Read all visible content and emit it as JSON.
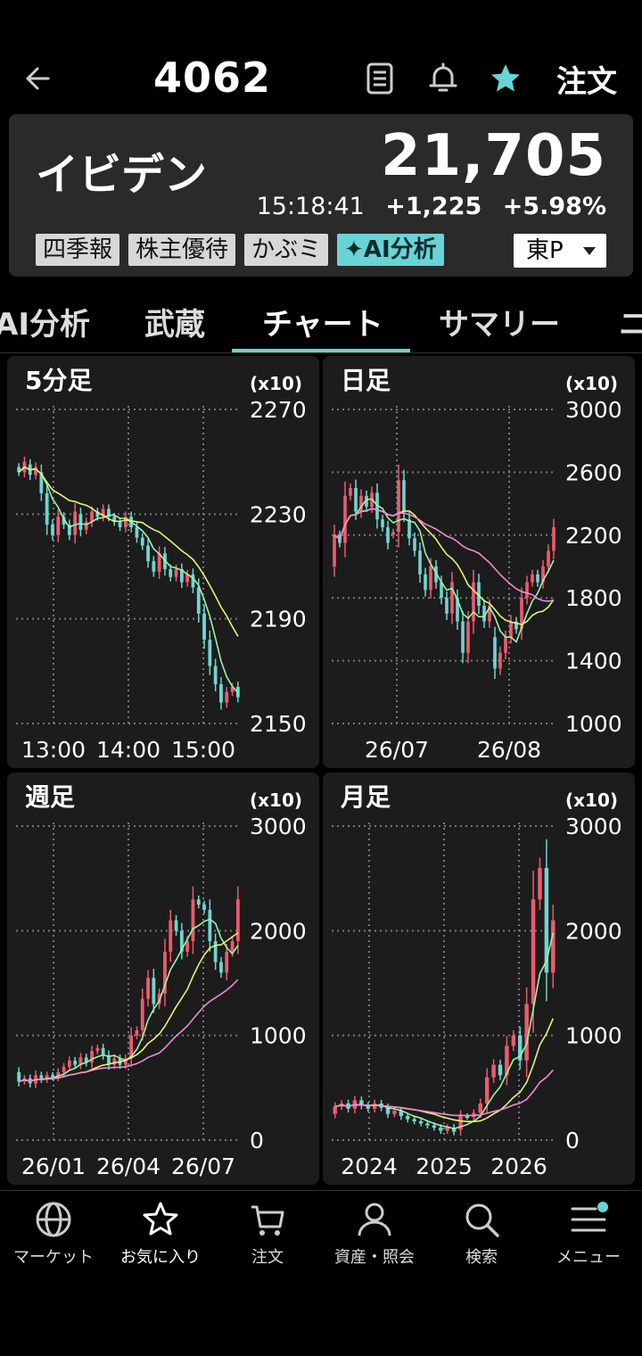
{
  "header": {
    "code": "4062",
    "order_label": "注文"
  },
  "quote": {
    "name": "イビデン",
    "price": "21,705",
    "time": "15:18:41",
    "change": "+1,225",
    "change_pct": "+5.98%",
    "tags": [
      "四季報",
      "株主優待",
      "かぶミ",
      "✦AI分析"
    ],
    "market": "東P"
  },
  "tabs": [
    "AI分析",
    "武蔵",
    "チャート",
    "サマリー",
    "ニ"
  ],
  "active_tab": "チャート",
  "colors": {
    "accent": "#69d3d6",
    "up": "#ef5a6f",
    "down": "#6fd6d2",
    "ma_short": "#9cf5a8",
    "ma_mid": "#e6f27a",
    "ma_long": "#f08ad6"
  },
  "chart_data": [
    {
      "type": "candlestick",
      "title": "5分足",
      "unit_label": "(x10)",
      "yticks": [
        2270,
        2230,
        2190,
        2150
      ],
      "ylim": [
        2150,
        2270
      ],
      "xticks": [
        "13:00",
        "14:00",
        "15:00"
      ],
      "grid": true,
      "ma": [
        "short",
        "mid"
      ],
      "series": [
        {
          "o": 2248,
          "c": 2246
        },
        {
          "o": 2246,
          "c": 2250
        },
        {
          "o": 2249,
          "c": 2245
        },
        {
          "o": 2245,
          "c": 2248
        },
        {
          "o": 2246,
          "c": 2238
        },
        {
          "o": 2238,
          "c": 2226
        },
        {
          "o": 2226,
          "c": 2222
        },
        {
          "o": 2222,
          "c": 2229
        },
        {
          "o": 2229,
          "c": 2226
        },
        {
          "o": 2226,
          "c": 2222
        },
        {
          "o": 2222,
          "c": 2231
        },
        {
          "o": 2230,
          "c": 2224
        },
        {
          "o": 2224,
          "c": 2227
        },
        {
          "o": 2227,
          "c": 2231
        },
        {
          "o": 2231,
          "c": 2229
        },
        {
          "o": 2229,
          "c": 2232
        },
        {
          "o": 2232,
          "c": 2229
        },
        {
          "o": 2229,
          "c": 2227
        },
        {
          "o": 2227,
          "c": 2225
        },
        {
          "o": 2225,
          "c": 2229
        },
        {
          "o": 2229,
          "c": 2225
        },
        {
          "o": 2225,
          "c": 2221
        },
        {
          "o": 2221,
          "c": 2218
        },
        {
          "o": 2218,
          "c": 2212
        },
        {
          "o": 2212,
          "c": 2208
        },
        {
          "o": 2208,
          "c": 2215
        },
        {
          "o": 2215,
          "c": 2209
        },
        {
          "o": 2209,
          "c": 2206
        },
        {
          "o": 2206,
          "c": 2209
        },
        {
          "o": 2209,
          "c": 2204
        },
        {
          "o": 2204,
          "c": 2207
        },
        {
          "o": 2207,
          "c": 2202
        },
        {
          "o": 2202,
          "c": 2192
        },
        {
          "o": 2192,
          "c": 2182
        },
        {
          "o": 2182,
          "c": 2172
        },
        {
          "o": 2172,
          "c": 2165
        },
        {
          "o": 2165,
          "c": 2158
        },
        {
          "o": 2158,
          "c": 2162
        },
        {
          "o": 2162,
          "c": 2164
        },
        {
          "o": 2164,
          "c": 2160
        }
      ]
    },
    {
      "type": "candlestick",
      "title": "日足",
      "unit_label": "(x10)",
      "yticks": [
        3000,
        2600,
        2200,
        1800,
        1400,
        1000
      ],
      "ylim": [
        1000,
        3000
      ],
      "xticks": [
        "26/07",
        "26/08"
      ],
      "grid": true,
      "ma": [
        "short",
        "mid",
        "long"
      ],
      "series": [
        {
          "o": 2000,
          "c": 2200
        },
        {
          "o": 2200,
          "c": 2150
        },
        {
          "o": 2150,
          "c": 2450
        },
        {
          "o": 2450,
          "c": 2500
        },
        {
          "o": 2500,
          "c": 2350
        },
        {
          "o": 2350,
          "c": 2450
        },
        {
          "o": 2450,
          "c": 2380
        },
        {
          "o": 2380,
          "c": 2470
        },
        {
          "o": 2470,
          "c": 2300
        },
        {
          "o": 2300,
          "c": 2250
        },
        {
          "o": 2250,
          "c": 2150
        },
        {
          "o": 2200,
          "c": 2220
        },
        {
          "o": 2220,
          "c": 2550
        },
        {
          "o": 2550,
          "c": 2350
        },
        {
          "o": 2300,
          "c": 2180
        },
        {
          "o": 2180,
          "c": 2100
        },
        {
          "o": 2100,
          "c": 1950
        },
        {
          "o": 1950,
          "c": 1850
        },
        {
          "o": 1850,
          "c": 2000
        },
        {
          "o": 2000,
          "c": 1900
        },
        {
          "o": 1900,
          "c": 1800
        },
        {
          "o": 1800,
          "c": 1700
        },
        {
          "o": 1700,
          "c": 1900
        },
        {
          "o": 1800,
          "c": 1650
        },
        {
          "o": 1650,
          "c": 1450
        },
        {
          "o": 1450,
          "c": 1650
        },
        {
          "o": 1650,
          "c": 1900
        },
        {
          "o": 1900,
          "c": 1750
        },
        {
          "o": 1750,
          "c": 1650
        },
        {
          "o": 1650,
          "c": 1750
        },
        {
          "o": 1550,
          "c": 1350
        },
        {
          "o": 1350,
          "c": 1450
        },
        {
          "o": 1450,
          "c": 1550
        },
        {
          "o": 1550,
          "c": 1650
        },
        {
          "o": 1650,
          "c": 1600
        },
        {
          "o": 1600,
          "c": 1800
        },
        {
          "o": 1800,
          "c": 1900
        },
        {
          "o": 1900,
          "c": 1950
        },
        {
          "o": 1950,
          "c": 1900
        },
        {
          "o": 1900,
          "c": 2000
        },
        {
          "o": 2000,
          "c": 2100
        },
        {
          "o": 2100,
          "c": 2250
        }
      ]
    },
    {
      "type": "candlestick",
      "title": "週足",
      "unit_label": "(x10)",
      "yticks": [
        3000,
        2000,
        1000,
        0
      ],
      "ylim": [
        0,
        3000
      ],
      "xticks": [
        "26/01",
        "26/04",
        "26/07"
      ],
      "grid": true,
      "ma": [
        "short",
        "mid",
        "long"
      ],
      "series": [
        {
          "o": 650,
          "c": 560
        },
        {
          "o": 560,
          "c": 590
        },
        {
          "o": 590,
          "c": 540
        },
        {
          "o": 540,
          "c": 620
        },
        {
          "o": 620,
          "c": 580
        },
        {
          "o": 580,
          "c": 620
        },
        {
          "o": 620,
          "c": 600
        },
        {
          "o": 600,
          "c": 650
        },
        {
          "o": 650,
          "c": 700
        },
        {
          "o": 700,
          "c": 760
        },
        {
          "o": 760,
          "c": 720
        },
        {
          "o": 720,
          "c": 790
        },
        {
          "o": 790,
          "c": 740
        },
        {
          "o": 740,
          "c": 850
        },
        {
          "o": 850,
          "c": 880
        },
        {
          "o": 880,
          "c": 810
        },
        {
          "o": 810,
          "c": 720
        },
        {
          "o": 720,
          "c": 780
        },
        {
          "o": 780,
          "c": 720
        },
        {
          "o": 720,
          "c": 780
        },
        {
          "o": 780,
          "c": 1000
        },
        {
          "o": 1000,
          "c": 1050
        },
        {
          "o": 1050,
          "c": 1350
        },
        {
          "o": 1350,
          "c": 1550
        },
        {
          "o": 1550,
          "c": 1300
        },
        {
          "o": 1300,
          "c": 1400
        },
        {
          "o": 1400,
          "c": 1800
        },
        {
          "o": 1800,
          "c": 2100
        },
        {
          "o": 2100,
          "c": 2000
        },
        {
          "o": 2000,
          "c": 1800
        },
        {
          "o": 1800,
          "c": 1900
        },
        {
          "o": 1900,
          "c": 2300
        },
        {
          "o": 2300,
          "c": 2250
        },
        {
          "o": 2250,
          "c": 2200
        },
        {
          "o": 2200,
          "c": 1900
        },
        {
          "o": 1900,
          "c": 1700
        },
        {
          "o": 1700,
          "c": 1600
        },
        {
          "o": 1600,
          "c": 1800
        },
        {
          "o": 1800,
          "c": 1900
        },
        {
          "o": 1900,
          "c": 2300
        }
      ]
    },
    {
      "type": "candlestick",
      "title": "月足",
      "unit_label": "(x10)",
      "yticks": [
        3000,
        2000,
        1000,
        0
      ],
      "ylim": [
        0,
        3000
      ],
      "xticks": [
        "2024",
        "2025",
        "2026"
      ],
      "grid": true,
      "ma": [
        "short",
        "mid",
        "long"
      ],
      "series": [
        {
          "o": 250,
          "c": 320
        },
        {
          "o": 320,
          "c": 350
        },
        {
          "o": 350,
          "c": 300
        },
        {
          "o": 300,
          "c": 380
        },
        {
          "o": 380,
          "c": 330
        },
        {
          "o": 330,
          "c": 300
        },
        {
          "o": 300,
          "c": 350
        },
        {
          "o": 350,
          "c": 310
        },
        {
          "o": 310,
          "c": 250
        },
        {
          "o": 250,
          "c": 280
        },
        {
          "o": 280,
          "c": 230
        },
        {
          "o": 230,
          "c": 200
        },
        {
          "o": 200,
          "c": 180
        },
        {
          "o": 180,
          "c": 160
        },
        {
          "o": 160,
          "c": 140
        },
        {
          "o": 140,
          "c": 120
        },
        {
          "o": 120,
          "c": 90
        },
        {
          "o": 90,
          "c": 120
        },
        {
          "o": 120,
          "c": 80
        },
        {
          "o": 100,
          "c": 230
        },
        {
          "o": 230,
          "c": 220
        },
        {
          "o": 220,
          "c": 260
        },
        {
          "o": 260,
          "c": 350
        },
        {
          "o": 350,
          "c": 600
        },
        {
          "o": 600,
          "c": 720
        },
        {
          "o": 720,
          "c": 620
        },
        {
          "o": 620,
          "c": 900
        },
        {
          "o": 900,
          "c": 1000
        },
        {
          "o": 1000,
          "c": 760
        },
        {
          "o": 760,
          "c": 1300
        },
        {
          "o": 1300,
          "c": 2300
        },
        {
          "o": 2300,
          "c": 2600
        },
        {
          "o": 2600,
          "c": 1600
        },
        {
          "o": 1600,
          "c": 2100
        }
      ]
    }
  ],
  "bottom_nav": [
    {
      "label": "マーケット",
      "icon": "globe-icon"
    },
    {
      "label": "お気に入り",
      "icon": "star-icon"
    },
    {
      "label": "注文",
      "icon": "cart-icon"
    },
    {
      "label": "資産・照会",
      "icon": "person-icon"
    },
    {
      "label": "検索",
      "icon": "search-icon"
    },
    {
      "label": "メニュー",
      "icon": "menu-icon"
    }
  ]
}
